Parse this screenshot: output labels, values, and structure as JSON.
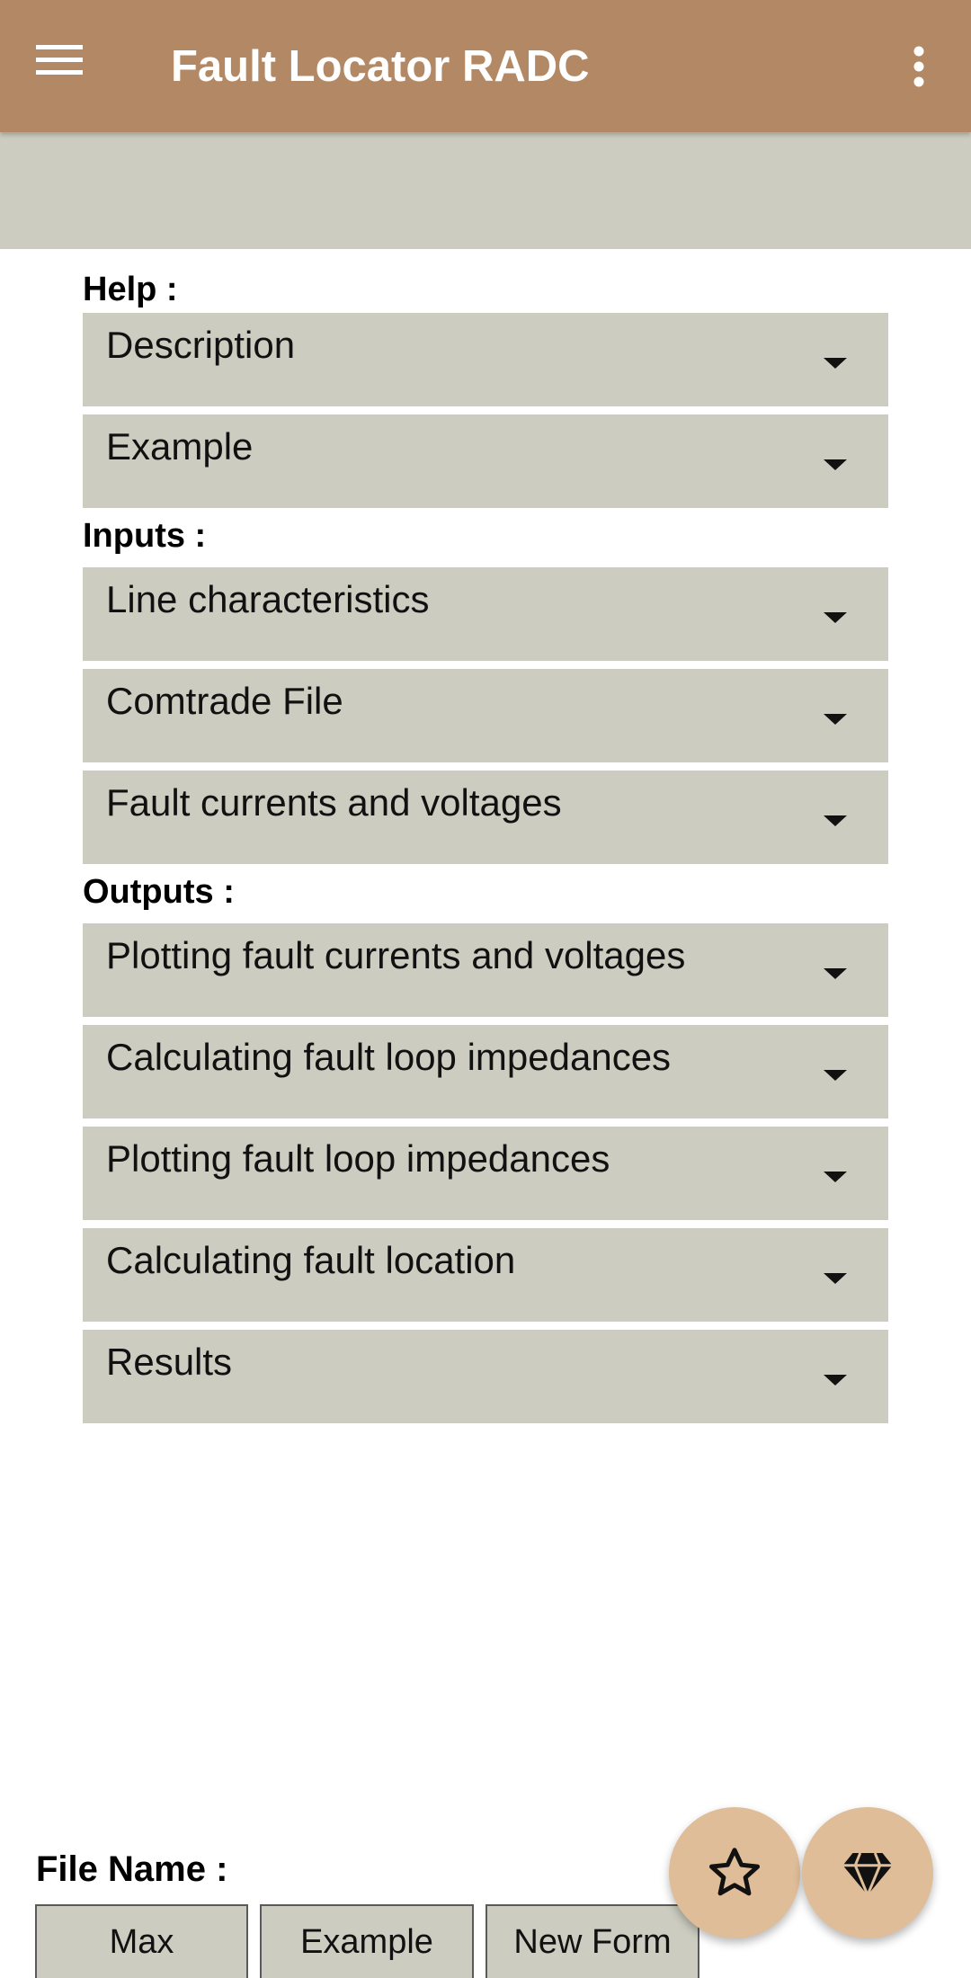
{
  "app": {
    "title": "Fault Locator RADC",
    "colors": {
      "appbar": "#b38865",
      "panel": "#cccdc0",
      "fab": "#dfbd98"
    },
    "icons": {
      "nav": "hamburger-menu-icon",
      "overflow": "more-vert-icon"
    }
  },
  "help": {
    "label": "Help :",
    "items": [
      {
        "label": "Description"
      },
      {
        "label": "Example"
      }
    ]
  },
  "inputs": {
    "label": "Inputs :",
    "items": [
      {
        "label": "Line characteristics"
      },
      {
        "label": "Comtrade File"
      },
      {
        "label": "Fault currents and voltages"
      }
    ]
  },
  "outputs": {
    "label": "Outputs :",
    "items": [
      {
        "label": "Plotting fault currents and voltages"
      },
      {
        "label": "Calculating fault loop impedances"
      },
      {
        "label": "Plotting fault loop impedances"
      },
      {
        "label": "Calculating fault location"
      },
      {
        "label": "Results"
      }
    ]
  },
  "file": {
    "label": "File Name :",
    "buttons": [
      {
        "label": "Max"
      },
      {
        "label": "Example"
      },
      {
        "label": "New Form"
      }
    ]
  },
  "fabs": [
    {
      "icon": "star-icon"
    },
    {
      "icon": "diamond-icon"
    }
  ]
}
